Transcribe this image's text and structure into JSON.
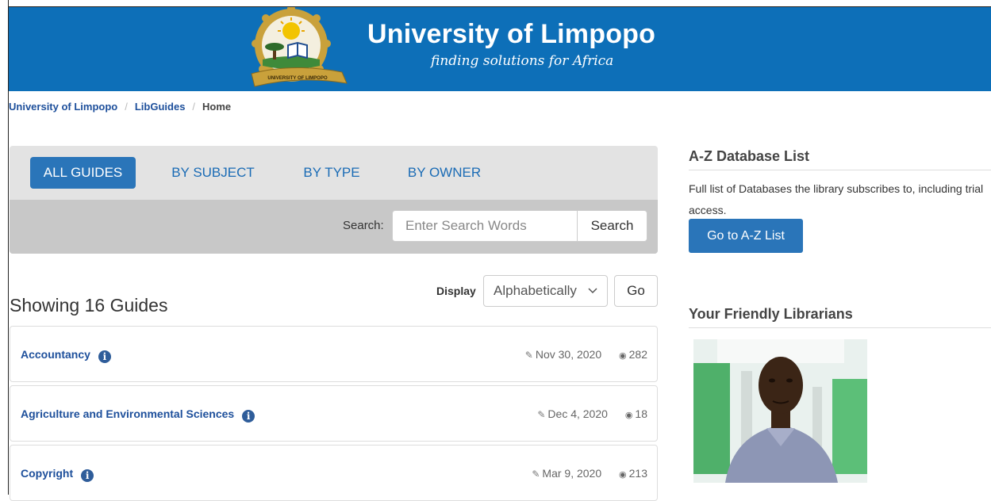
{
  "header": {
    "title": "University of Limpopo",
    "tagline": "finding solutions for Africa",
    "logo_text": "UNIVERSITY OF LIMPOPO"
  },
  "breadcrumb": {
    "items": [
      "University of Limpopo",
      "LibGuides",
      "Home"
    ],
    "separator": "/"
  },
  "tabs": [
    {
      "label": "ALL GUIDES",
      "active": true
    },
    {
      "label": "BY SUBJECT",
      "active": false
    },
    {
      "label": "BY TYPE",
      "active": false
    },
    {
      "label": "BY OWNER",
      "active": false
    }
  ],
  "search": {
    "label": "Search:",
    "placeholder": "Enter Search Words",
    "button": "Search"
  },
  "display": {
    "label": "Display",
    "selected": "Alphabetically",
    "go": "Go"
  },
  "showing": "Showing 16 Guides",
  "guides": [
    {
      "title": "Accountancy",
      "updated": "Nov 30, 2020",
      "views": "282"
    },
    {
      "title": "Agriculture and Environmental Sciences",
      "updated": "Dec 4, 2020",
      "views": "18"
    },
    {
      "title": "Copyright",
      "updated": "Mar 9, 2020",
      "views": "213"
    }
  ],
  "sidebar": {
    "az_heading": "A-Z Database List",
    "az_text": "Full list of Databases the library subscribes to, including trial access.",
    "az_button": "Go to A-Z List",
    "librarians_heading": "Your Friendly Librarians"
  },
  "colors": {
    "banner": "#0d6fb8",
    "primary_button": "#2a75b9",
    "link": "#1d4f9b"
  },
  "icons": {
    "info": "info-icon",
    "edit": "edit-icon",
    "views": "eye-icon",
    "dropdown": "chevron-down-icon"
  }
}
